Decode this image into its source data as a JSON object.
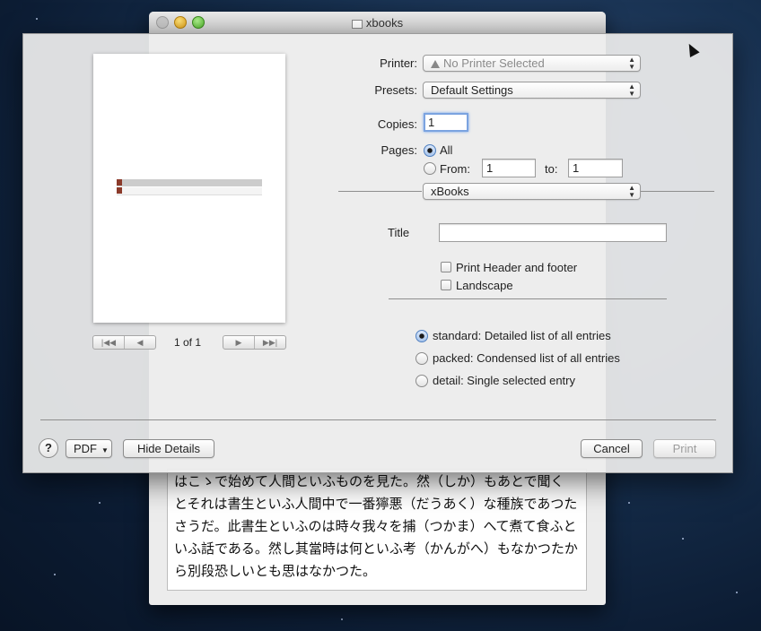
{
  "back_window": {
    "title": "xbooks",
    "text_lines": [
      "はこゝで始めて人間といふものを見た。然（しか）もあとで聞く",
      "とそれは書生といふ人間中で一番獰悪（だうあく）な種族であつた",
      "さうだ。此書生といふのは時々我々を捕（つかま）へて煮て食ふと",
      "いふ話である。然し其當時は何といふ考（かんがへ）もなかつたか",
      "ら別段恐しいとも思はなかつた。"
    ]
  },
  "print_dialog": {
    "preview": {
      "page_indicator": "1 of 1"
    },
    "printer": {
      "label": "Printer:",
      "value": "No Printer Selected"
    },
    "presets": {
      "label": "Presets:",
      "value": "Default Settings"
    },
    "copies": {
      "label": "Copies:",
      "value": "1"
    },
    "pages": {
      "label": "Pages:",
      "all_label": "All",
      "from_label": "From:",
      "from_value": "1",
      "to_label": "to:",
      "to_value": "1",
      "selected": "All"
    },
    "section_popup": {
      "value": "xBooks"
    },
    "title_field": {
      "label": "Title",
      "value": ""
    },
    "options": {
      "header_footer": {
        "label": "Print Header and footer",
        "checked": false
      },
      "landscape": {
        "label": "Landscape",
        "checked": false
      }
    },
    "layout_options": [
      {
        "label": "standard: Detailed list of all entries",
        "selected": true
      },
      {
        "label": "packed: Condensed list of all entries",
        "selected": false
      },
      {
        "label": "detail: Single selected entry",
        "selected": false
      }
    ],
    "buttons": {
      "help": "?",
      "pdf": "PDF",
      "hide_details": "Hide Details",
      "cancel": "Cancel",
      "print": "Print"
    }
  }
}
